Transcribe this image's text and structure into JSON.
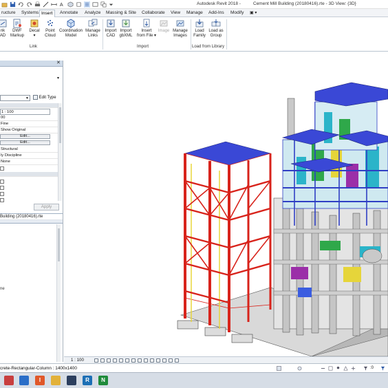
{
  "window": {
    "app_title": "Autodesk Revit 2018 -",
    "doc_title": "Cement Mill Building (20180416).rte - 3D View: {3D}"
  },
  "tabs": [
    {
      "label": "ructure",
      "active": false
    },
    {
      "label": "Systems",
      "active": false
    },
    {
      "label": "Insert",
      "active": true
    },
    {
      "label": "Annotate",
      "active": false
    },
    {
      "label": "Analyze",
      "active": false
    },
    {
      "label": "Massing & Site",
      "active": false
    },
    {
      "label": "Collaborate",
      "active": false
    },
    {
      "label": "View",
      "active": false
    },
    {
      "label": "Manage",
      "active": false
    },
    {
      "label": "Add-Ins",
      "active": false
    },
    {
      "label": "Modify",
      "active": false
    }
  ],
  "ribbon": {
    "link_buttons": [
      {
        "l1": "nk",
        "l2": "AD"
      },
      {
        "l1": "DWF",
        "l2": "Markup"
      },
      {
        "l1": "Decal",
        "l2": "▾"
      },
      {
        "l1": "Point",
        "l2": "Cloud"
      },
      {
        "l1": "Coordination",
        "l2": "Model"
      },
      {
        "l1": "Manage",
        "l2": "Links"
      }
    ],
    "import_buttons": [
      {
        "l1": "Import",
        "l2": "CAD"
      },
      {
        "l1": "Import",
        "l2": "gbXML"
      },
      {
        "l1": "Insert",
        "l2": "from File ▾"
      },
      {
        "l1": "Image",
        "l2": ""
      },
      {
        "l1": "Manage",
        "l2": "Images"
      }
    ],
    "library_buttons": [
      {
        "l1": "Load",
        "l2": "Family"
      },
      {
        "l1": "Load as",
        "l2": "Group"
      }
    ],
    "groups": {
      "link": "Link",
      "import": "Import",
      "library": "Load from Library"
    }
  },
  "properties": {
    "edit_type": "Edit Type",
    "rows": [
      {
        "text": "1 : 100",
        "kind": "field"
      },
      {
        "text": "00",
        "kind": "field"
      },
      {
        "text": "Fine",
        "kind": "field"
      },
      {
        "text": "Show Original",
        "kind": "field"
      },
      {
        "text": "Edit...",
        "kind": "button"
      },
      {
        "text": "Edit...",
        "kind": "button"
      },
      {
        "text": "Structural",
        "kind": "field"
      },
      {
        "text": "ly Discipline",
        "kind": "field"
      },
      {
        "text": "None",
        "kind": "field"
      }
    ],
    "apply": "Apply"
  },
  "browser": {
    "title": "Building (20180416).rte",
    "items": [
      "ne"
    ]
  },
  "view_control": {
    "scale": "1 : 100"
  },
  "status": {
    "text": "crete-Rectangular-Column : 1400x1400"
  },
  "colors": {
    "frame_red": "#d8231b",
    "beam_blue": "#2f3fc4",
    "concrete": "#c9c9c9",
    "roof_blue": "#3a48d6"
  },
  "taskbar": [
    {
      "icon": "revit-icon",
      "letter": "",
      "color": "#c83f3f"
    },
    {
      "icon": "ms-edge-icon",
      "letter": "",
      "color": "#2a6ec8"
    },
    {
      "icon": "fire-app-icon",
      "letter": "I",
      "color": "#e0582a"
    },
    {
      "icon": "folder-icon",
      "letter": "",
      "color": "#e2b13a"
    },
    {
      "icon": "steam-icon",
      "letter": "",
      "color": "#2c3f5e"
    },
    {
      "icon": "revit-r-icon",
      "letter": "R",
      "color": "#1c6fb5"
    },
    {
      "icon": "navisworks-icon",
      "letter": "N",
      "color": "#1f8b3b"
    }
  ]
}
